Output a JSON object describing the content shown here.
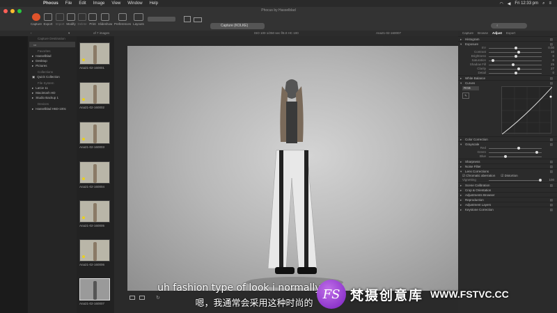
{
  "menubar": {
    "apple": "",
    "items": [
      "Phocus",
      "File",
      "Edit",
      "Image",
      "View",
      "Window",
      "Help"
    ],
    "clock": "Fri 12:33 pm"
  },
  "window": {
    "title": "Phocus by Hasselblad"
  },
  "toolbar": {
    "buttons": [
      "Capture",
      "Export",
      "Import",
      "Modify",
      "Delete",
      "Print",
      "Slideshow",
      "Preferences",
      "Layouts"
    ],
    "show_label": "Show",
    "portrait_label": "Portrait/Landscape",
    "adjustments_label": "Adjustments",
    "capture_dropdown": "Capture (KOLKE)",
    "search_label": "Search"
  },
  "subbar": {
    "images_count": "of 7 images",
    "exif": "ISO 100  1/250 sec  f/8.0  HC 100",
    "filename": "Ana21-02-160007"
  },
  "leftpanel": {
    "header": "Capture Destination",
    "favorites_label": "Favorites",
    "items": [
      "Hasselblad",
      "Desktop",
      "Pictures"
    ],
    "collections_label": "Collections",
    "quick_collection": "Quick Collection",
    "file_system_label": "File System",
    "volumes": [
      "LaCie 11",
      "Macintosh HD",
      "Studio Backup 1"
    ],
    "devices_label": "Devices",
    "device": "Hasselblad H6D-100c"
  },
  "thumbnails": [
    "Ana21-02-160001",
    "Ana21-02-160002",
    "Ana21-02-160003",
    "Ana21-02-160004",
    "Ana21-02-160005",
    "Ana21-02-160006",
    "Ana21-02-160007"
  ],
  "rightpanel": {
    "tabs": [
      "Capture",
      "Browse",
      "Adjust",
      "Export"
    ],
    "histogram": "Histogram",
    "exposure": "Exposure",
    "exposure_sliders": [
      {
        "label": "EV",
        "value": "0.00",
        "pos": 0.5
      },
      {
        "label": "Contrast",
        "value": "10",
        "pos": 0.55
      },
      {
        "label": "Brightness",
        "value": "0",
        "pos": 0.5
      },
      {
        "label": "Saturation",
        "value": "0",
        "pos": 0.05
      },
      {
        "label": "Shadow Fill",
        "value": "25",
        "pos": 0.45
      },
      {
        "label": "Clarity",
        "value": "27",
        "pos": 0.55
      },
      {
        "label": "Detail",
        "value": "0",
        "pos": 0.5
      }
    ],
    "white_balance": "White Balance",
    "curves": "Curves",
    "curve_channel": "RGB",
    "color_correction": "Color Correction",
    "grayscale": "Grayscale",
    "grayscale_sliders": [
      {
        "label": "Red",
        "value": "",
        "pos": 0.55
      },
      {
        "label": "Green",
        "value": "",
        "pos": 0.9
      },
      {
        "label": "Blue",
        "value": "",
        "pos": 0.3
      }
    ],
    "sharpness": "Sharpness",
    "noise_filter": "Noise Filter",
    "lens_corrections": "Lens Corrections",
    "lens_options": [
      "Chromatic aberration",
      "Distortion",
      "Vignetting"
    ],
    "vignetting_value": "100",
    "more_tools": [
      "Scene Calibration",
      "Crop & Orientation",
      "Adjustments Browser",
      "Reproduction",
      "Adjustment Layers",
      "Keystone Correction"
    ]
  },
  "subtitles": {
    "en": "uh fashion type of look i normally d",
    "zh": "嗯，我通常会采用这种时尚的"
  },
  "watermark": {
    "logo": "FS",
    "brand": "梵摄创意库",
    "url": "WWW.FSTVC.CC"
  }
}
